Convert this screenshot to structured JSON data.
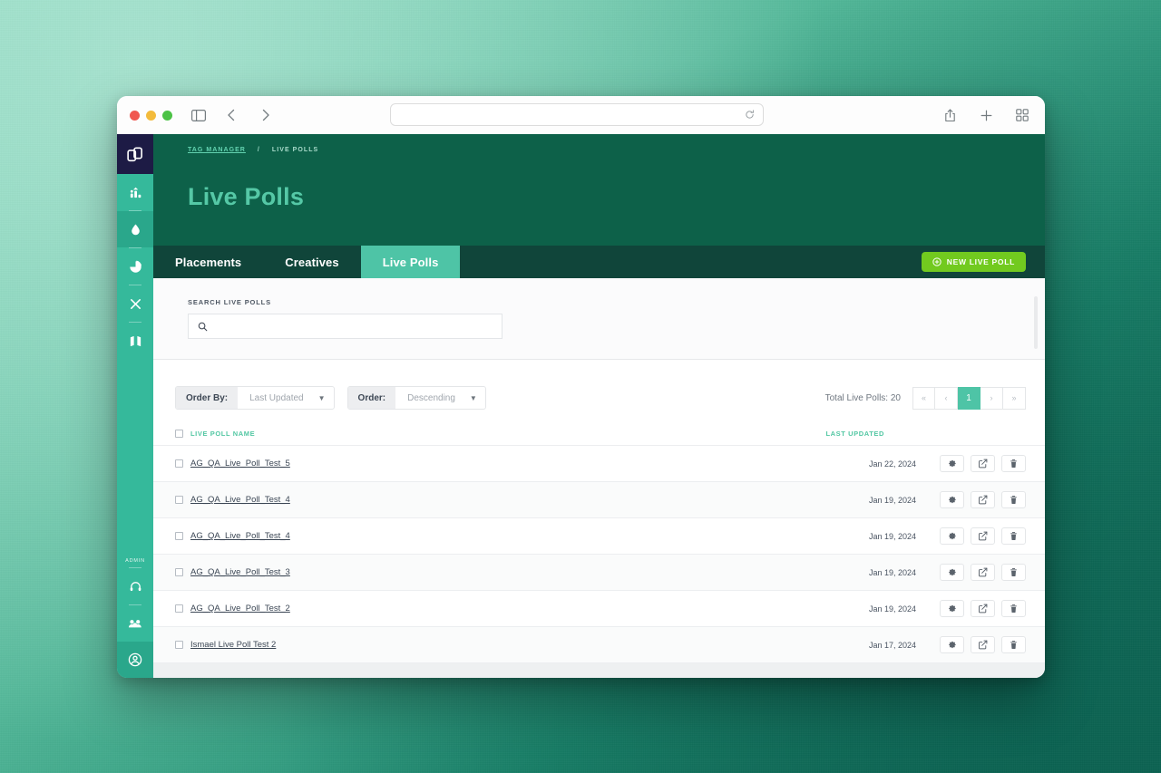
{
  "browser": {
    "url_value": "",
    "url_placeholder": "",
    "icons": {
      "sidebar_toggle": "sidebar-toggle-icon",
      "back": "back-chevron-icon",
      "forward": "forward-chevron-icon",
      "reload": "reload-icon",
      "share": "share-icon",
      "new_tab": "plus-icon",
      "tab_overview": "tab-overview-icon"
    }
  },
  "rail": {
    "logo": "app-logo",
    "items": [
      {
        "icon": "bar-chart-icon",
        "active": false
      },
      {
        "icon": "droplet-icon",
        "active": true
      },
      {
        "icon": "pie-chart-icon",
        "active": false
      },
      {
        "icon": "scissors-icon",
        "active": false
      },
      {
        "icon": "map-icon",
        "active": false
      }
    ],
    "admin_label": "ADMIN",
    "admin_items": [
      {
        "icon": "headset-icon"
      },
      {
        "icon": "users-icon"
      }
    ],
    "avatar": "user-avatar-icon"
  },
  "hero": {
    "breadcrumb": {
      "root": "TAG MANAGER",
      "separator": "/",
      "current": "LIVE POLLS"
    },
    "title": "Live Polls"
  },
  "tabs": [
    {
      "label": "Placements",
      "active": false
    },
    {
      "label": "Creatives",
      "active": false
    },
    {
      "label": "Live Polls",
      "active": true
    }
  ],
  "new_poll_button": {
    "label": "NEW LIVE POLL",
    "icon": "plus-circle-icon"
  },
  "search": {
    "label": "SEARCH LIVE POLLS",
    "value": "",
    "placeholder": "",
    "icon": "search-icon"
  },
  "toolbar": {
    "order_by_label": "Order By:",
    "order_by_value": "Last Updated",
    "order_label": "Order:",
    "order_value": "Descending",
    "total_text": "Total Live Polls: 20",
    "pager": {
      "first": "«",
      "prev": "‹",
      "current": "1",
      "next": "›",
      "last": "»"
    }
  },
  "table": {
    "headers": {
      "name": "LIVE POLL NAME",
      "updated": "LAST UPDATED"
    },
    "rows": [
      {
        "name": "AG_QA_Live_Poll_Test_5",
        "updated": "Jan 22, 2024"
      },
      {
        "name": "AG_QA_Live_Poll_Test_4",
        "updated": "Jan 19, 2024"
      },
      {
        "name": "AG_QA_Live_Poll_Test_4",
        "updated": "Jan 19, 2024"
      },
      {
        "name": "AG_QA_Live_Poll_Test_3",
        "updated": "Jan 19, 2024"
      },
      {
        "name": "AG_QA_Live_Poll_Test_2",
        "updated": "Jan 19, 2024"
      },
      {
        "name": "Ismael Live Poll Test 2",
        "updated": "Jan 17, 2024"
      }
    ],
    "row_actions": [
      {
        "icon": "gear-icon"
      },
      {
        "icon": "edit-external-icon"
      },
      {
        "icon": "trash-icon"
      }
    ]
  },
  "colors": {
    "hero_bg": "#0d6149",
    "tabbar_bg": "#10453a",
    "accent_teal": "#4ec4a6",
    "rail_bg": "#35b99b",
    "logo_bg": "#1d1b45",
    "cta_green": "#72ca1f",
    "mint_text": "#55c8a6"
  }
}
